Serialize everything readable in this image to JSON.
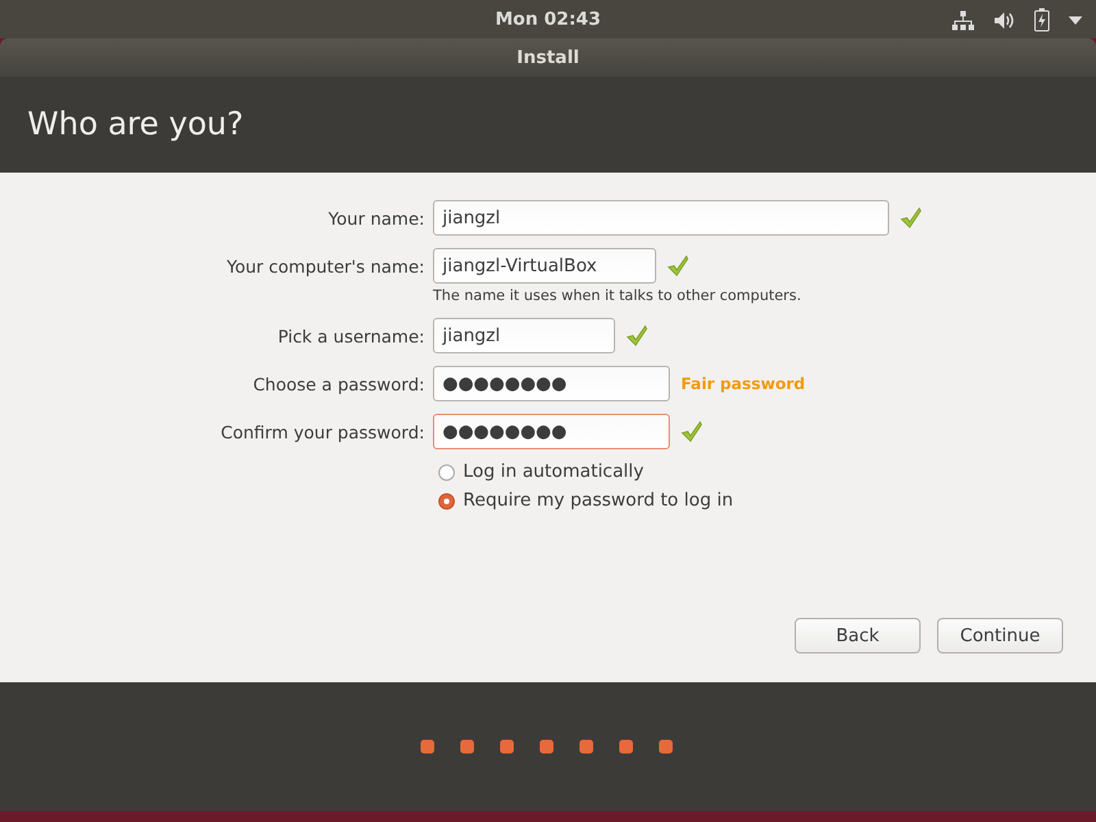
{
  "top_bar": {
    "clock": "Mon 02:43"
  },
  "window": {
    "title": "Install"
  },
  "header": {
    "title": "Who are you?"
  },
  "fields": [
    {
      "label": "Your name:",
      "value": "jiangzl",
      "valid": true,
      "focused": false
    },
    {
      "label": "Your computer's name:",
      "value": "jiangzl-VirtualBox",
      "valid": true,
      "focused": false,
      "hint": "The name it uses when it talks to other computers."
    },
    {
      "label": "Pick a username:",
      "value": "jiangzl",
      "valid": true,
      "focused": false
    },
    {
      "label": "Choose a password:",
      "value": "●●●●●●●●",
      "valid": false,
      "focused": false,
      "strength": "Fair password"
    },
    {
      "label": "Confirm your password:",
      "value": "●●●●●●●●",
      "valid": true,
      "focused": true
    }
  ],
  "login_options": [
    {
      "label": "Log in automatically",
      "selected": false
    },
    {
      "label": "Require my password to log in",
      "selected": true
    }
  ],
  "buttons": [
    "Back",
    "Continue"
  ]
}
